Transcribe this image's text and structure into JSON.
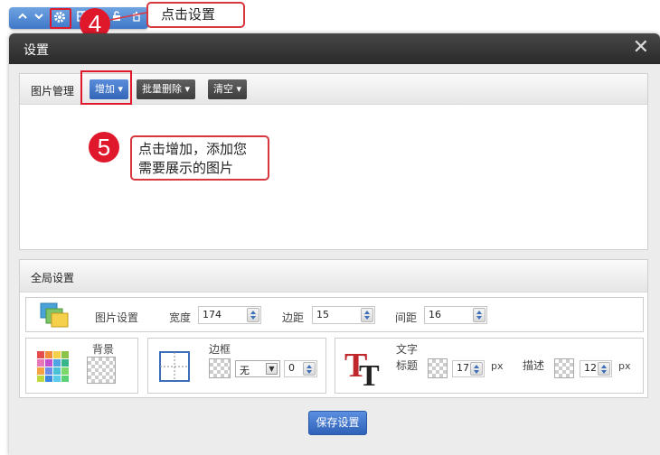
{
  "toolbar": {
    "icons": [
      "chevron-up-icon",
      "chevron-down-icon",
      "gear-icon",
      "grid-icon",
      "lock-icon",
      "trash-icon"
    ],
    "step_number": "4",
    "callout": "点击设置"
  },
  "dialog": {
    "title": "设置",
    "close_glyph": "✕"
  },
  "image_manager": {
    "title": "图片管理",
    "add_button": "增加",
    "batch_delete_button": "批量删除",
    "clear_button": "清空",
    "step_number": "5",
    "callout_line1": "点击增加，添加您",
    "callout_line2": "需要展示的图片"
  },
  "global_settings": {
    "title": "全局设置",
    "image_settings": {
      "label": "图片设置",
      "width_label": "宽度",
      "width_value": "174",
      "margin_label": "边距",
      "margin_value": "15",
      "spacing_label": "间距",
      "spacing_value": "16"
    },
    "background": {
      "label": "背景"
    },
    "border": {
      "label": "边框",
      "style_value": "无",
      "width_value": "0"
    },
    "text": {
      "label": "文字",
      "title_label": "标题",
      "title_size": "17",
      "title_unit": "px",
      "desc_label": "描述",
      "desc_size": "12",
      "desc_unit": "px"
    }
  },
  "save_button": "保存设置",
  "colors": {
    "accent_blue": "#3465b8",
    "marker_red": "#e0182c",
    "dialog_header": "#2a2a2a"
  }
}
